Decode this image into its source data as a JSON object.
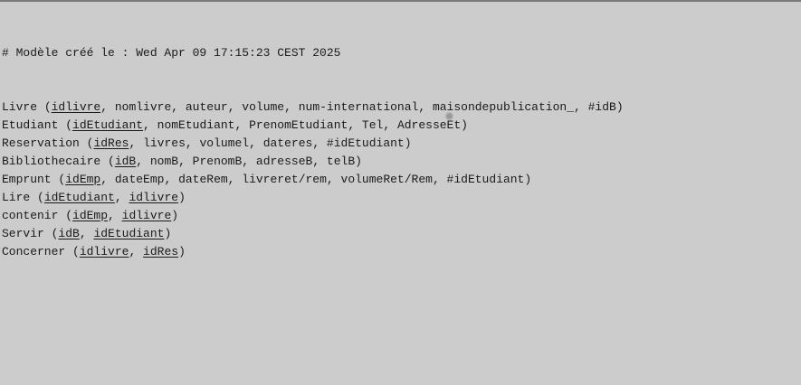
{
  "comment": "# Modèle créé le : Wed Apr 09 17:15:23 CEST 2025",
  "relations": [
    {
      "name": "Livre",
      "attrs": [
        {
          "text": "idlivre",
          "key": true
        },
        {
          "text": "nomlivre",
          "key": false
        },
        {
          "text": "auteur",
          "key": false
        },
        {
          "text": "volume",
          "key": false
        },
        {
          "text": "num-international",
          "key": false
        },
        {
          "text": "maisondepublication_",
          "key": false
        },
        {
          "text": "#idB",
          "key": false
        }
      ]
    },
    {
      "name": "Etudiant",
      "attrs": [
        {
          "text": "idEtudiant",
          "key": true
        },
        {
          "text": "nomEtudiant",
          "key": false
        },
        {
          "text": "PrenomEtudiant",
          "key": false
        },
        {
          "text": "Tel",
          "key": false
        },
        {
          "text": "AdresseEt",
          "key": false
        }
      ]
    },
    {
      "name": "Reservation",
      "attrs": [
        {
          "text": "idRes",
          "key": true
        },
        {
          "text": "livres",
          "key": false
        },
        {
          "text": "volumel",
          "key": false
        },
        {
          "text": "dateres",
          "key": false
        },
        {
          "text": "#idEtudiant",
          "key": false
        }
      ]
    },
    {
      "name": "Bibliothecaire",
      "attrs": [
        {
          "text": "idB",
          "key": true
        },
        {
          "text": "nomB",
          "key": false
        },
        {
          "text": "PrenomB",
          "key": false
        },
        {
          "text": "adresseB",
          "key": false
        },
        {
          "text": "telB",
          "key": false
        }
      ]
    },
    {
      "name": "Emprunt",
      "attrs": [
        {
          "text": "idEmp",
          "key": true
        },
        {
          "text": "dateEmp",
          "key": false
        },
        {
          "text": "dateRem",
          "key": false
        },
        {
          "text": "livreret/rem",
          "key": false
        },
        {
          "text": "volumeRet/Rem",
          "key": false
        },
        {
          "text": "#idEtudiant",
          "key": false
        }
      ]
    },
    {
      "name": "Lire",
      "attrs": [
        {
          "text": "idEtudiant",
          "key": true
        },
        {
          "text": "idlivre",
          "key": true
        }
      ]
    },
    {
      "name": "contenir",
      "attrs": [
        {
          "text": "idEmp",
          "key": true
        },
        {
          "text": "idlivre",
          "key": true
        }
      ]
    },
    {
      "name": "Servir",
      "attrs": [
        {
          "text": "idB",
          "key": true
        },
        {
          "text": "idEtudiant",
          "key": true
        }
      ]
    },
    {
      "name": "Concerner",
      "attrs": [
        {
          "text": "idlivre",
          "key": true
        },
        {
          "text": "idRes",
          "key": true
        }
      ]
    }
  ],
  "colors": {
    "background": "#cccccc",
    "text": "#1a1a1a",
    "top_border": "#7a7a7a"
  }
}
